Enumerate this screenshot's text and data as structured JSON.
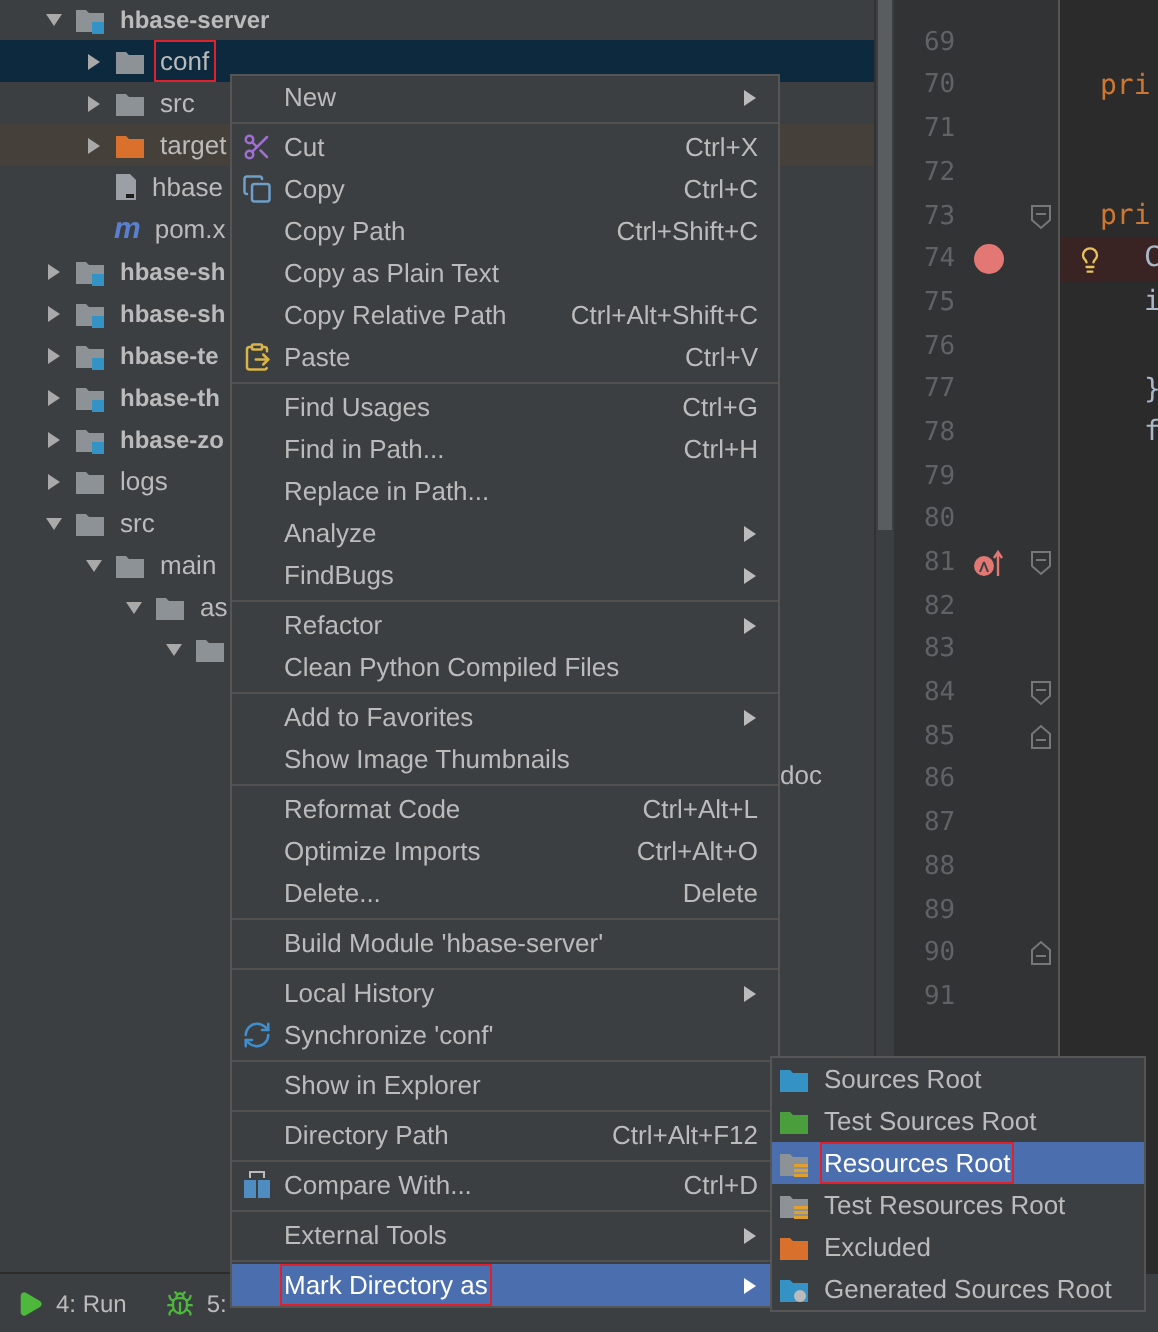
{
  "tree": [
    {
      "label": "hbase-server",
      "kind": "module",
      "expanded": true,
      "selected": false,
      "highlighted": false,
      "children": [
        {
          "label": "conf",
          "kind": "folder",
          "expanded": false,
          "selected": true,
          "highlighted": true
        },
        {
          "label": "src",
          "kind": "folder",
          "expanded": false,
          "selected": false,
          "highlighted": false
        },
        {
          "label": "target",
          "kind": "excluded",
          "expanded": false,
          "selected": false,
          "highlighted": false
        },
        {
          "label": "hbase",
          "kind": "file",
          "selected": false,
          "highlighted": false
        },
        {
          "label": "pom.x",
          "kind": "maven",
          "icon_text": "m",
          "selected": false,
          "highlighted": false
        }
      ]
    },
    {
      "label": "hbase-sh",
      "kind": "module",
      "expanded": false,
      "selected": false,
      "highlighted": false
    },
    {
      "label": "hbase-sh",
      "kind": "module",
      "expanded": false,
      "selected": false,
      "highlighted": false
    },
    {
      "label": "hbase-te",
      "kind": "module",
      "expanded": false,
      "selected": false,
      "highlighted": false
    },
    {
      "label": "hbase-th",
      "kind": "module",
      "expanded": false,
      "selected": false,
      "highlighted": false
    },
    {
      "label": "hbase-zo",
      "kind": "module",
      "expanded": false,
      "selected": false,
      "highlighted": false
    },
    {
      "label": "logs",
      "kind": "folder",
      "expanded": false,
      "selected": false,
      "highlighted": false
    },
    {
      "label": "src",
      "kind": "folder",
      "expanded": true,
      "selected": false,
      "highlighted": false,
      "children": [
        {
          "label": "main",
          "kind": "folder",
          "expanded": true,
          "selected": false,
          "highlighted": false,
          "children": [
            {
              "label": "as",
              "kind": "folder",
              "expanded": true,
              "selected": false,
              "highlighted": false,
              "children": [
                {
                  "kind": "folder",
                  "expanded": true,
                  "selected": false
                }
              ]
            }
          ]
        }
      ]
    }
  ],
  "hidden_row_text": "doc",
  "editor": {
    "lines": [
      {
        "number": "69"
      },
      {
        "number": "70",
        "code": {
          "text": "pri",
          "kind": "member"
        }
      },
      {
        "number": "71"
      },
      {
        "number": "72"
      },
      {
        "number": "73",
        "code": {
          "text": "pri",
          "kind": "member"
        },
        "fold": {
          "kind": "start"
        }
      },
      {
        "number": "74",
        "code": {
          "text": "C",
          "kind": "body"
        },
        "breakpoint": {
          "kind": "line"
        },
        "bulb": true
      },
      {
        "number": "75",
        "code": {
          "text": "i",
          "kind": "body"
        }
      },
      {
        "number": "76"
      },
      {
        "number": "77",
        "code": {
          "text": "}",
          "kind": "body"
        }
      },
      {
        "number": "78",
        "code": {
          "text": "f",
          "kind": "body"
        }
      },
      {
        "number": "79"
      },
      {
        "number": "80"
      },
      {
        "number": "81",
        "breakpoint": {
          "kind": "lambda"
        },
        "fold": {
          "kind": "start"
        }
      },
      {
        "number": "82"
      },
      {
        "number": "83"
      },
      {
        "number": "84",
        "fold": {
          "kind": "start"
        }
      },
      {
        "number": "85",
        "fold": {
          "kind": "end"
        }
      },
      {
        "number": "86"
      },
      {
        "number": "87"
      },
      {
        "number": "88"
      },
      {
        "number": "89"
      },
      {
        "number": "90",
        "fold": {
          "kind": "end"
        }
      },
      {
        "number": "91"
      }
    ]
  },
  "status_bar": [
    {
      "label": "4: Run",
      "kind": "run"
    },
    {
      "label": "5:",
      "kind": "debug"
    }
  ],
  "context_menu": [
    [
      {
        "label": "New",
        "submenu": true,
        "selected": false,
        "highlighted": false
      }
    ],
    [
      {
        "label": "Cut",
        "shortcut": "Ctrl+X",
        "kind": "cut",
        "selected": false,
        "highlighted": false
      },
      {
        "label": "Copy",
        "shortcut": "Ctrl+C",
        "kind": "copy",
        "selected": false,
        "highlighted": false
      },
      {
        "label": "Copy Path",
        "shortcut": "Ctrl+Shift+C",
        "selected": false,
        "highlighted": false
      },
      {
        "label": "Copy as Plain Text",
        "selected": false,
        "highlighted": false
      },
      {
        "label": "Copy Relative Path",
        "shortcut": "Ctrl+Alt+Shift+C",
        "selected": false,
        "highlighted": false
      },
      {
        "label": "Paste",
        "shortcut": "Ctrl+V",
        "kind": "paste",
        "selected": false,
        "highlighted": false
      }
    ],
    [
      {
        "label": "Find Usages",
        "shortcut": "Ctrl+G",
        "selected": false,
        "highlighted": false
      },
      {
        "label": "Find in Path...",
        "shortcut": "Ctrl+H",
        "selected": false,
        "highlighted": false
      },
      {
        "label": "Replace in Path...",
        "selected": false,
        "highlighted": false
      },
      {
        "label": "Analyze",
        "submenu": true,
        "selected": false,
        "highlighted": false
      },
      {
        "label": "FindBugs",
        "submenu": true,
        "selected": false,
        "highlighted": false
      }
    ],
    [
      {
        "label": "Refactor",
        "submenu": true,
        "selected": false,
        "highlighted": false
      },
      {
        "label": "Clean Python Compiled Files",
        "selected": false,
        "highlighted": false
      }
    ],
    [
      {
        "label": "Add to Favorites",
        "submenu": true,
        "selected": false,
        "highlighted": false
      },
      {
        "label": "Show Image Thumbnails",
        "selected": false,
        "highlighted": false
      }
    ],
    [
      {
        "label": "Reformat Code",
        "shortcut": "Ctrl+Alt+L",
        "selected": false,
        "highlighted": false
      },
      {
        "label": "Optimize Imports",
        "shortcut": "Ctrl+Alt+O",
        "selected": false,
        "highlighted": false
      },
      {
        "label": "Delete...",
        "shortcut": "Delete",
        "selected": false,
        "highlighted": false
      }
    ],
    [
      {
        "label": "Build Module 'hbase-server'",
        "selected": false,
        "highlighted": false
      }
    ],
    [
      {
        "label": "Local History",
        "submenu": true,
        "selected": false,
        "highlighted": false
      },
      {
        "label": "Synchronize 'conf'",
        "kind": "sync",
        "selected": false,
        "highlighted": false
      }
    ],
    [
      {
        "label": "Show in Explorer",
        "selected": false,
        "highlighted": false
      }
    ],
    [
      {
        "label": "Directory Path",
        "shortcut": "Ctrl+Alt+F12",
        "selected": false,
        "highlighted": false
      }
    ],
    [
      {
        "label": "Compare With...",
        "shortcut": "Ctrl+D",
        "kind": "compare",
        "selected": false,
        "highlighted": false
      }
    ],
    [
      {
        "label": "External Tools",
        "submenu": true,
        "selected": false,
        "highlighted": false
      }
    ],
    [
      {
        "label": "Mark Directory as",
        "submenu": true,
        "selected": true,
        "highlighted": true
      }
    ]
  ],
  "submenu": [
    {
      "label": "Sources Root",
      "kind": "sources",
      "selected": false,
      "highlighted": false
    },
    {
      "label": "Test Sources Root",
      "kind": "test-sources",
      "selected": false,
      "highlighted": false
    },
    {
      "label": "Resources Root",
      "kind": "resources",
      "selected": true,
      "highlighted": true
    },
    {
      "label": "Test Resources Root",
      "kind": "test-resources",
      "selected": false,
      "highlighted": false
    },
    {
      "label": "Excluded",
      "kind": "excluded",
      "selected": false,
      "highlighted": false
    },
    {
      "label": "Generated Sources Root",
      "kind": "generated",
      "selected": false,
      "highlighted": false
    }
  ]
}
